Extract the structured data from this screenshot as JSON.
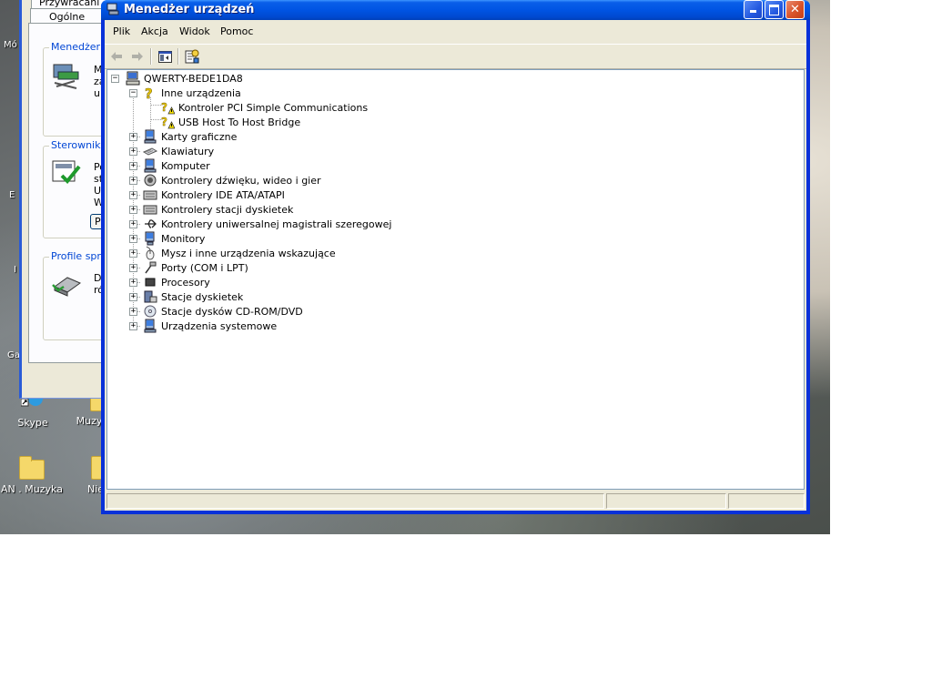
{
  "desktop": {
    "icons": [
      {
        "label": "Skype"
      },
      {
        "label": "Muzy"
      },
      {
        "label": "AN . Muzyka"
      },
      {
        "label": "Nie"
      }
    ],
    "edge_labels": [
      "Mó",
      "E",
      "I",
      "Ga"
    ]
  },
  "system_properties": {
    "tabs": [
      "Przywracani",
      "Ogólne"
    ],
    "groups": [
      {
        "title": "Menedżer u",
        "text": [
          "M",
          "za",
          "ur"
        ]
      },
      {
        "title": "Sterowniki",
        "text": [
          "Po",
          "st",
          "U",
          "W"
        ],
        "button": "P"
      },
      {
        "title": "Profile sprzę",
        "text": [
          "Da",
          "ró"
        ]
      }
    ]
  },
  "device_manager": {
    "title": "Menedżer urządzeń",
    "menu": [
      "Plik",
      "Akcja",
      "Widok",
      "Pomoc"
    ],
    "toolbar": [
      {
        "icon": "back-arrow-icon"
      },
      {
        "icon": "forward-arrow-icon"
      },
      {
        "icon": "show-hide-tree-icon"
      },
      {
        "icon": "properties-icon"
      }
    ],
    "root": "QWERTY-BEDE1DA8",
    "other_devices": {
      "label": "Inne urządzenia",
      "children": [
        "Kontroler PCI Simple Communications",
        "USB Host To Host Bridge"
      ]
    },
    "categories": [
      {
        "label": "Karty graficzne",
        "icon": "display-adapter-icon"
      },
      {
        "label": "Klawiatury",
        "icon": "keyboard-icon"
      },
      {
        "label": "Komputer",
        "icon": "computer-icon"
      },
      {
        "label": "Kontrolery dźwięku, wideo i gier",
        "icon": "sound-icon"
      },
      {
        "label": "Kontrolery IDE ATA/ATAPI",
        "icon": "ide-controller-icon"
      },
      {
        "label": "Kontrolery stacji dyskietek",
        "icon": "floppy-controller-icon"
      },
      {
        "label": "Kontrolery uniwersalnej magistrali szeregowej",
        "icon": "usb-icon"
      },
      {
        "label": "Monitory",
        "icon": "monitor-icon"
      },
      {
        "label": "Mysz i inne urządzenia wskazujące",
        "icon": "mouse-icon"
      },
      {
        "label": "Porty (COM i LPT)",
        "icon": "port-icon"
      },
      {
        "label": "Procesory",
        "icon": "processor-icon"
      },
      {
        "label": "Stacje dyskietek",
        "icon": "floppy-drive-icon"
      },
      {
        "label": "Stacje dysków CD-ROM/DVD",
        "icon": "cdrom-icon"
      },
      {
        "label": "Urządzenia systemowe",
        "icon": "system-devices-icon"
      }
    ]
  }
}
